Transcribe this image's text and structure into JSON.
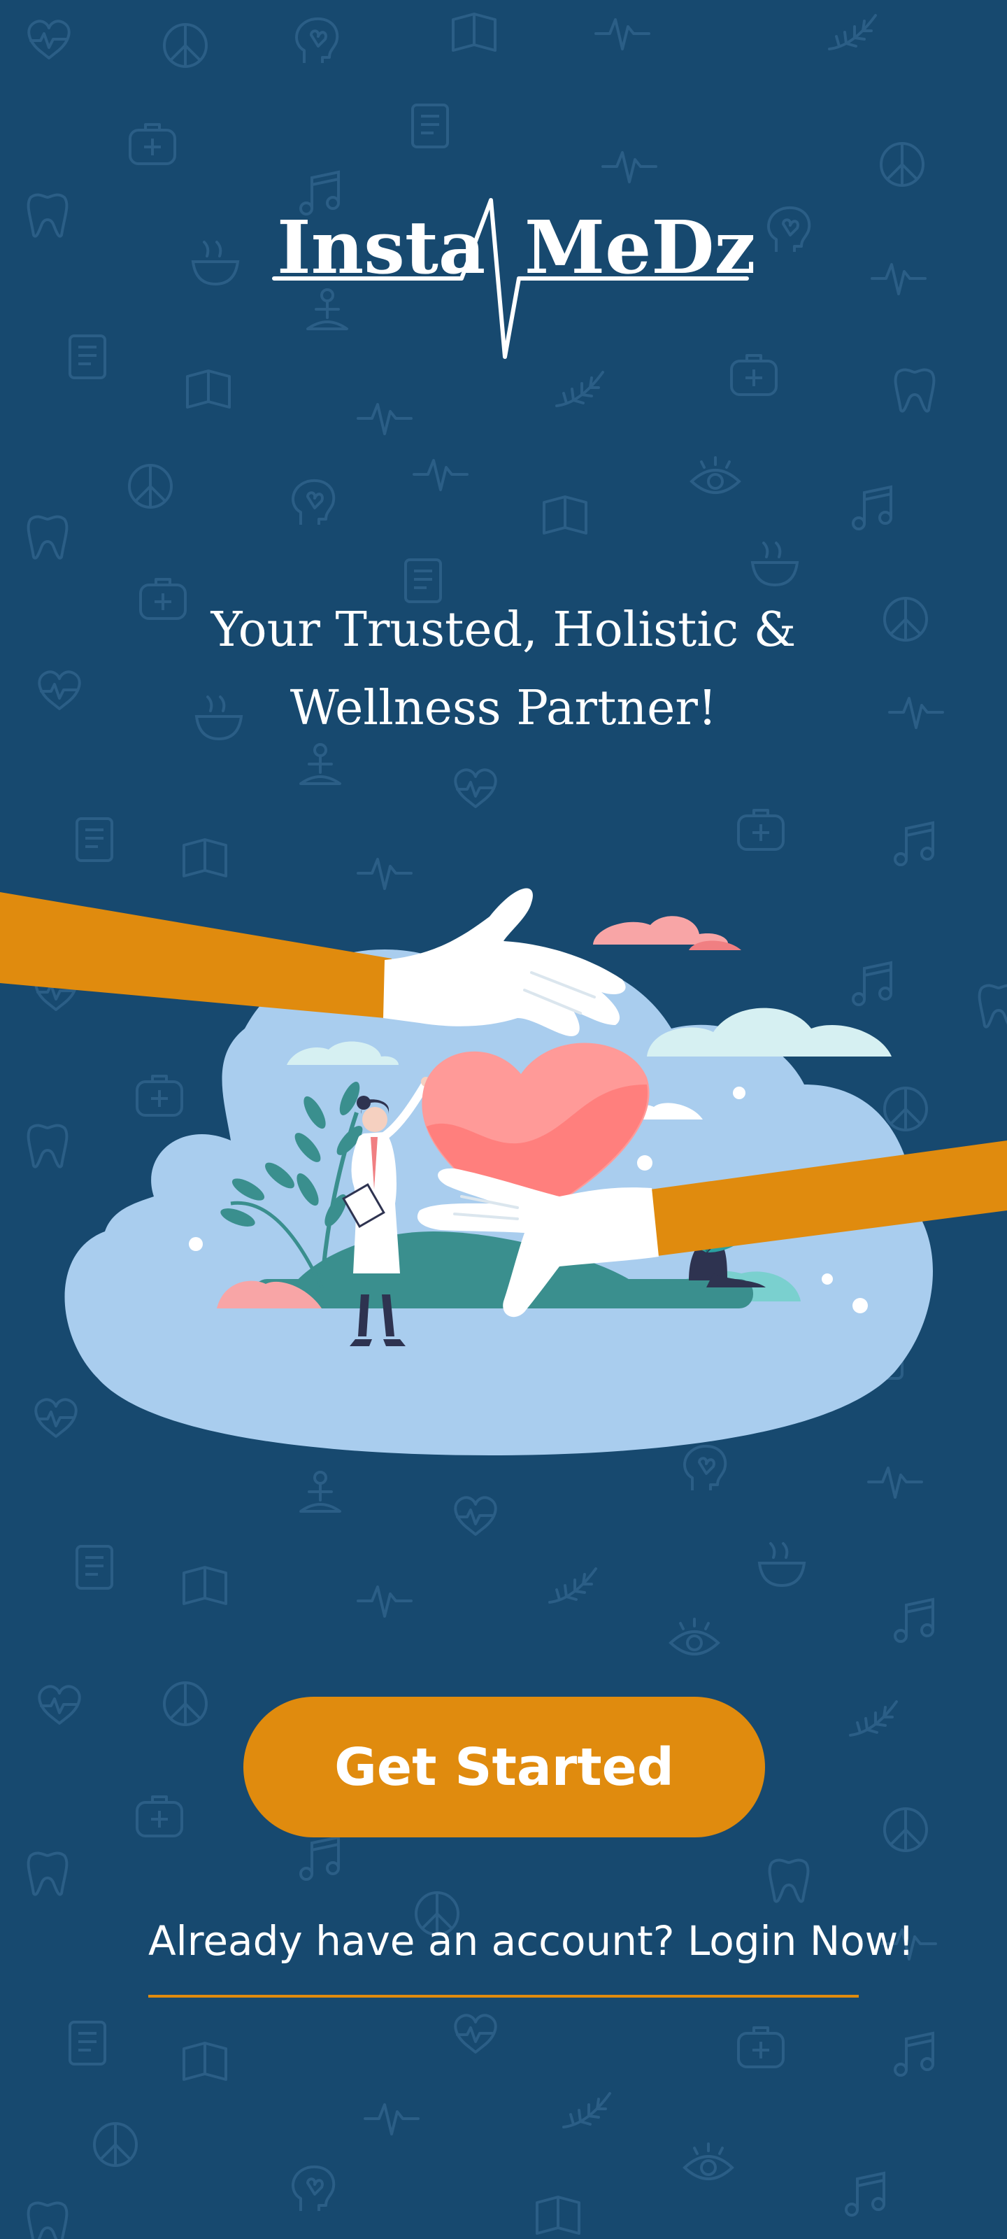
{
  "app": {
    "logo_text_left": "Insta",
    "logo_text_right": "MeDz"
  },
  "tagline": {
    "line1": "Your Trusted, Holistic &",
    "line2": "Wellness Partner!"
  },
  "actions": {
    "get_started_label": "Get Started",
    "login_prompt": "Already have an account?",
    "login_link": "Login Now!"
  },
  "colors": {
    "background": "#17496f",
    "accent": "#e08b0e",
    "cloud": "#a9cdee",
    "heart": "#ff7f7d",
    "text": "#ffffff"
  },
  "icons": [
    "heart-pulse-icon",
    "peace-icon",
    "brain-heart-icon",
    "book-icon",
    "ecg-icon",
    "first-aid-kit-icon",
    "clipboard-icon",
    "meditation-icon",
    "music-notes-icon",
    "eye-icon",
    "tooth-icon",
    "bowl-icon",
    "leaf-icon"
  ]
}
